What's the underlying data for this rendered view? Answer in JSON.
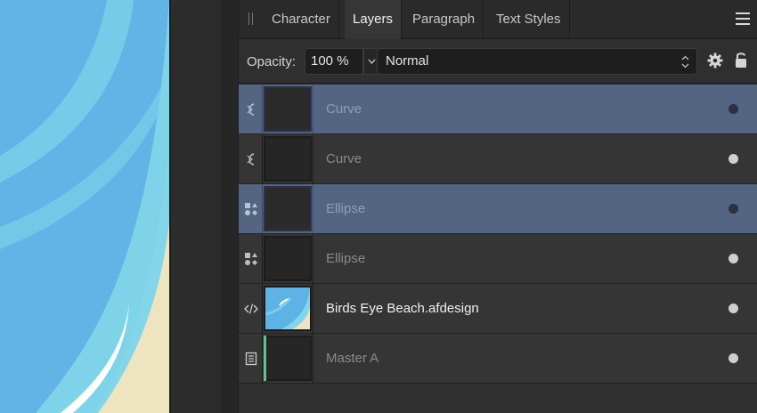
{
  "panel": {
    "tabs": [
      {
        "label": "Character",
        "active": false
      },
      {
        "label": "Layers",
        "active": true
      },
      {
        "label": "Paragraph",
        "active": false
      },
      {
        "label": "Text Styles",
        "active": false
      }
    ],
    "menu_icon": "hamburger-menu-icon"
  },
  "toolbar": {
    "opacity_label": "Opacity:",
    "opacity_value": "100 %",
    "blend_mode": "Normal",
    "settings_icon": "gear-icon",
    "lock_icon": "lock-icon"
  },
  "layers": [
    {
      "name": "Curve",
      "type_icon": "curve-icon",
      "selected": true,
      "visible": true
    },
    {
      "name": "Curve",
      "type_icon": "curve-icon",
      "selected": false,
      "visible": true
    },
    {
      "name": "Ellipse",
      "type_icon": "shapes-icon",
      "selected": true,
      "visible": true
    },
    {
      "name": "Ellipse",
      "type_icon": "shapes-icon",
      "selected": false,
      "visible": true
    },
    {
      "name": "Birds Eye Beach.afdesign",
      "type_icon": "embedded-document-icon",
      "selected": false,
      "visible": true
    },
    {
      "name": "Master A",
      "type_icon": "master-page-icon",
      "selected": false,
      "visible": true
    }
  ],
  "colors": {
    "selection": "#546582",
    "sea": "#62b4e7",
    "shallow": "#7ed3e8",
    "sand": "#ece5c0",
    "master_accent": "#5dc09a"
  }
}
